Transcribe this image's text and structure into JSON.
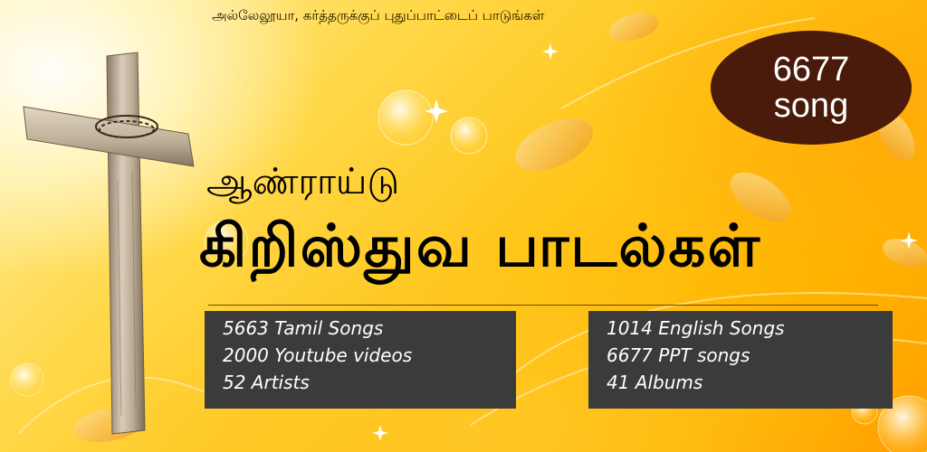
{
  "banner": {
    "slogan": "அல்லேலூயா, கர்த்தருக்குப் புதுப்பாட்டைப் பாடுங்கள்",
    "count_badge": {
      "number": "6677",
      "unit": "song"
    },
    "subtitle": "ஆண்ராய்டு",
    "title": "கிறிஸ்துவ பாடல்கள்",
    "stats_left": [
      "5663 Tamil Songs",
      "2000 Youtube videos",
      "52 Artists"
    ],
    "stats_right": [
      "1014 English Songs",
      "6677 PPT songs",
      "41 Albums"
    ]
  },
  "colors": {
    "badge": "#4a1a0a",
    "panel": "#3b3b3b",
    "background_primary": "#ffc61a"
  },
  "icons": [
    "cross-icon",
    "leaf-icon",
    "bubble-icon",
    "sparkle-icon"
  ]
}
